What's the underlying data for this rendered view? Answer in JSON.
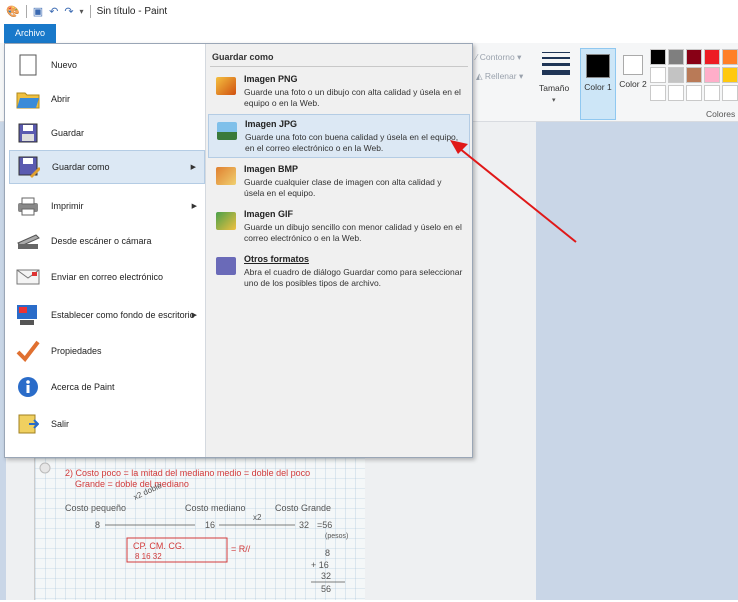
{
  "window": {
    "title": "Sin título - Paint"
  },
  "tabs": {
    "archivo": "Archivo"
  },
  "ribbon": {
    "contorno": "Contorno",
    "rellenar": "Rellenar",
    "tamano": "Tamaño",
    "color1": "Color 1",
    "color2": "Color 2",
    "colores": "Colores",
    "palette": [
      "#000000",
      "#7f7f7f",
      "#880015",
      "#ed1c24",
      "#ff7f27",
      "#ffffff",
      "#ffffff",
      "#c3c3c3",
      "#b97a57",
      "#ffaec9",
      "#ffc90e",
      "#ffffff",
      "#ffffff",
      "#ffffff",
      "#ffffff",
      "#ffffff",
      "#ffffff",
      "#ffffff"
    ]
  },
  "file_menu": {
    "items": [
      {
        "label": "Nuevo",
        "icon": "new-page-icon"
      },
      {
        "label": "Abrir",
        "icon": "open-folder-icon"
      },
      {
        "label": "Guardar",
        "icon": "save-disk-icon"
      },
      {
        "label": "Guardar como",
        "icon": "save-as-icon"
      },
      {
        "label": "Imprimir",
        "icon": "printer-icon"
      },
      {
        "label": "Desde escáner o cámara",
        "icon": "scanner-icon"
      },
      {
        "label": "Enviar en correo electrónico",
        "icon": "email-icon"
      },
      {
        "label": "Establecer como fondo de escritorio",
        "icon": "desktop-background-icon"
      },
      {
        "label": "Propiedades",
        "icon": "checkmark-icon"
      },
      {
        "label": "Acerca de Paint",
        "icon": "info-icon"
      },
      {
        "label": "Salir",
        "icon": "exit-icon"
      }
    ],
    "save_as": {
      "heading": "Guardar como",
      "options": [
        {
          "name": "Imagen PNG",
          "desc": "Guarde una foto o un dibujo con alta calidad y úsela en el equipo o en la Web."
        },
        {
          "name": "Imagen JPG",
          "desc": "Guarde una foto con buena calidad y úsela en el equipo, en el correo electrónico o en la Web."
        },
        {
          "name": "Imagen BMP",
          "desc": "Guarde cualquier clase de imagen con alta calidad y úsela en el equipo."
        },
        {
          "name": "Imagen GIF",
          "desc": "Guarde un dibujo sencillo con menor calidad y úselo en el correo electrónico o en la Web."
        },
        {
          "name": "Otros formatos",
          "desc": "Abra el cuadro de diálogo Guardar como para seleccionar uno de los posibles tipos de archivo."
        }
      ]
    }
  },
  "canvas_note": {
    "line1": "2) Costo poco = la mitad del mediano  medio = doble del poco",
    "line2": "Grande = doble del mediano",
    "col1": "Costo pequeño",
    "col2": "Costo mediano",
    "col3": "Costo Grande",
    "doble": "x2 doble",
    "v1": "8",
    "v2": "16",
    "v3": "32",
    "x2": "x2",
    "eq": "=56",
    "pesos": "(pesos)",
    "box": "CP. CM. CG.",
    "boxv": "8  16  32",
    "r": "= R//",
    "sum1": "8",
    "sum2": "+ 16",
    "sum3": "32",
    "sum4": "56"
  }
}
